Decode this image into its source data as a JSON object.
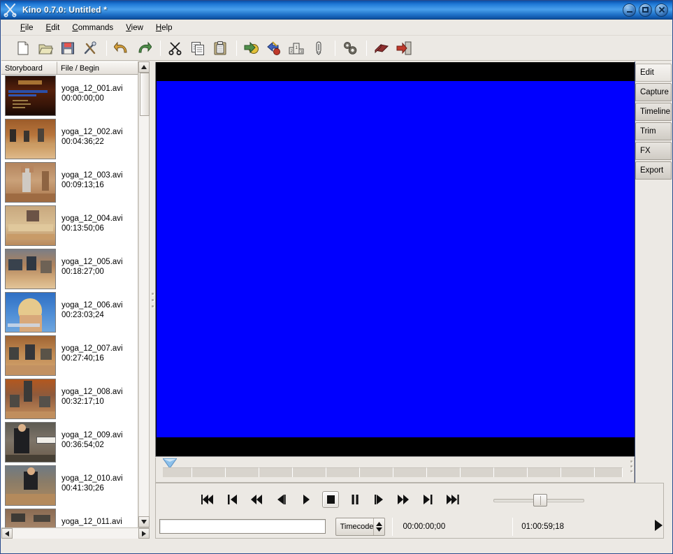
{
  "window": {
    "title": "Kino 0.7.0: Untitled *",
    "icon": "kino-scissors-icon",
    "buttons": {
      "minimize": "minimize",
      "maximize": "maximize",
      "close": "close"
    }
  },
  "menubar": {
    "items": [
      {
        "label": "File",
        "accel": "F"
      },
      {
        "label": "Edit",
        "accel": "E"
      },
      {
        "label": "Commands",
        "accel": "C"
      },
      {
        "label": "View",
        "accel": "V"
      },
      {
        "label": "Help",
        "accel": "H"
      }
    ]
  },
  "toolbar": {
    "buttons": [
      {
        "name": "new-icon",
        "title": "New"
      },
      {
        "name": "open-folder-icon",
        "title": "Open"
      },
      {
        "name": "save-floppy-icon",
        "title": "Save"
      },
      {
        "name": "preferences-tools-icon",
        "title": "Preferences"
      },
      {
        "name": "undo-arrow-icon",
        "title": "Undo"
      },
      {
        "name": "redo-arrow-icon",
        "title": "Redo"
      },
      {
        "name": "cut-scissors-icon",
        "title": "Cut"
      },
      {
        "name": "copy-icon",
        "title": "Copy"
      },
      {
        "name": "paste-clipboard-icon",
        "title": "Paste"
      },
      {
        "name": "goto-scene-icon",
        "title": "Go To"
      },
      {
        "name": "split-scene-icon",
        "title": "Split Scene"
      },
      {
        "name": "join-scene-icon",
        "title": "Join Scene"
      },
      {
        "name": "attach-clip-icon",
        "title": "Attach"
      },
      {
        "name": "settings-gears-icon",
        "title": "Settings"
      },
      {
        "name": "manual-book-icon",
        "title": "Manual"
      },
      {
        "name": "quit-exit-icon",
        "title": "Quit"
      }
    ]
  },
  "storyboard": {
    "columns": [
      "Storyboard",
      "File / Begin"
    ],
    "rows": [
      {
        "file": "yoga_12_001.avi",
        "begin": "00:00:00;00",
        "thumb": "title-screen"
      },
      {
        "file": "yoga_12_002.avi",
        "begin": "00:04:36;22",
        "thumb": "class-wide-shot"
      },
      {
        "file": "yoga_12_003.avi",
        "begin": "00:09:13;16",
        "thumb": "arms-up-pose"
      },
      {
        "file": "yoga_12_004.avi",
        "begin": "00:13:50;06",
        "thumb": "floor-stretch"
      },
      {
        "file": "yoga_12_005.avi",
        "begin": "00:18:27;00",
        "thumb": "downward-dog"
      },
      {
        "file": "yoga_12_006.avi",
        "begin": "00:23:03;24",
        "thumb": "blue-sky-portrait"
      },
      {
        "file": "yoga_12_007.avi",
        "begin": "00:27:40;16",
        "thumb": "group-floor-pose"
      },
      {
        "file": "yoga_12_008.avi",
        "begin": "00:32:17;10",
        "thumb": "standing-balance"
      },
      {
        "file": "yoga_12_009.avi",
        "begin": "00:36:54;02",
        "thumb": "instructor-assist"
      },
      {
        "file": "yoga_12_010.avi",
        "begin": "00:41:30;26",
        "thumb": "seated-forward-bend"
      },
      {
        "file": "yoga_12_011.avi",
        "begin": "",
        "thumb": "mats-floor"
      }
    ]
  },
  "tabs": {
    "items": [
      {
        "label": "Edit",
        "active": true
      },
      {
        "label": "Capture",
        "active": false
      },
      {
        "label": "Timeline",
        "active": false
      },
      {
        "label": "Trim",
        "active": false
      },
      {
        "label": "FX",
        "active": false
      },
      {
        "label": "Export",
        "active": false
      }
    ]
  },
  "viewer": {
    "letterbox_color": "#000000",
    "frame_color": "#0000ff"
  },
  "scrubber": {
    "segments": 14,
    "marker_position": "start"
  },
  "transport": {
    "buttons": [
      {
        "name": "skip-to-start-button",
        "glyph": "first"
      },
      {
        "name": "previous-scene-button",
        "glyph": "prev-scene"
      },
      {
        "name": "rewind-button",
        "glyph": "rewind"
      },
      {
        "name": "step-back-button",
        "glyph": "step-back"
      },
      {
        "name": "play-button",
        "glyph": "play"
      },
      {
        "name": "stop-button",
        "glyph": "stop",
        "pressed": true
      },
      {
        "name": "pause-button",
        "glyph": "pause"
      },
      {
        "name": "step-forward-button",
        "glyph": "step-forward"
      },
      {
        "name": "fast-forward-button",
        "glyph": "fast-forward"
      },
      {
        "name": "next-scene-button",
        "glyph": "next-scene"
      },
      {
        "name": "skip-to-end-button",
        "glyph": "last"
      }
    ],
    "volume": {
      "value": 50
    }
  },
  "statusbar": {
    "position_input_value": "",
    "position_input_placeholder": "",
    "mode_selector": "Timecode",
    "current_timecode": "00:00:00;00",
    "total_timecode": "01:00:59;18",
    "play_indicator": "play-triangle-icon"
  },
  "colors": {
    "titlebar_blue": "#1f78d6",
    "video_blue": "#0000ff",
    "chrome_gray": "#ece9e4",
    "selection_blue": "#316ac5"
  }
}
